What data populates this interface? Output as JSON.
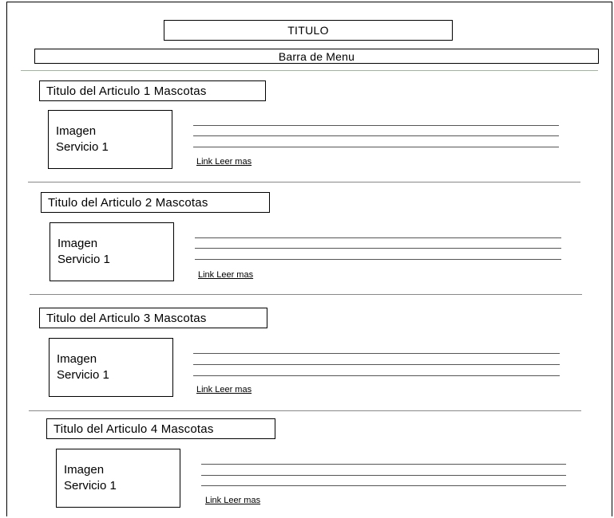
{
  "header": {
    "title": "TITULO",
    "menu_bar": "Barra de Menu"
  },
  "articles": [
    {
      "title": "Titulo del Articulo 1 Mascotas",
      "image_line1": "Imagen",
      "image_line2": "Servicio 1",
      "link": "Link Leer mas"
    },
    {
      "title": "Titulo del Articulo 2  Mascotas",
      "image_line1": "Imagen",
      "image_line2": "Servicio 1",
      "link": "Link Leer mas"
    },
    {
      "title": "Titulo del Articulo 3  Mascotas",
      "image_line1": "Imagen",
      "image_line2": "Servicio 1",
      "link": "Link Leer mas"
    },
    {
      "title": "Titulo del Articulo 4  Mascotas",
      "image_line1": "Imagen",
      "image_line2": "Servicio 1",
      "link": "Link Leer mas"
    }
  ]
}
